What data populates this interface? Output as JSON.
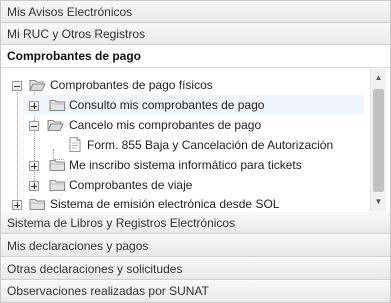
{
  "menu": {
    "top_sections": [
      {
        "label": "Mis Avisos Electrónicos"
      },
      {
        "label": "Mi RUC y Otros Registros"
      }
    ],
    "active_section": {
      "label": "Comprobantes de pago"
    },
    "tree": {
      "root": {
        "label": "Comprobantes de pago físicos",
        "state": "expanded"
      },
      "items": [
        {
          "label": "Consulto mis comprobantes de pago",
          "state": "collapsed"
        },
        {
          "label": "Cancelo mis comprobantes de pago",
          "state": "expanded"
        },
        {
          "label": "Form. 855 Baja y Cancelación de Autorización",
          "state": "leaf"
        },
        {
          "label": "Me inscribo sistema informático para tickets",
          "state": "collapsed"
        },
        {
          "label": "Comprobantes de viaje",
          "state": "collapsed"
        }
      ],
      "next_root": {
        "label": "Sistema de emisión electrónica desde SOL",
        "state": "collapsed"
      }
    },
    "bottom_sections": [
      {
        "label": "Sistema de Libros y Registros Electrónicos"
      },
      {
        "label": "Mis declaraciones y pagos"
      },
      {
        "label": "Otras declaraciones y solicitudes"
      },
      {
        "label": "Observaciones realizadas por SUNAT"
      }
    ]
  }
}
